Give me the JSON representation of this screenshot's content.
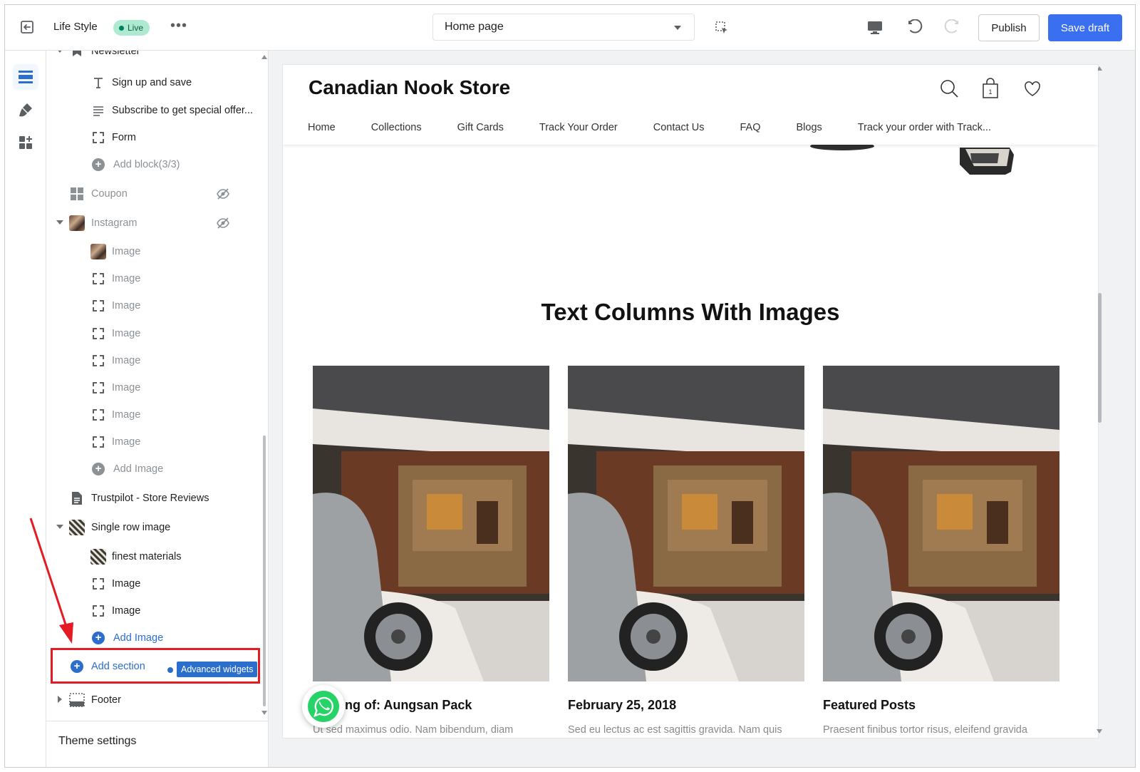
{
  "topbar": {
    "theme_name": "Life Style",
    "live_badge": "Live",
    "more_label": "•••",
    "page_select": "Home page",
    "publish_label": "Publish",
    "save_label": "Save draft"
  },
  "sidebar": {
    "partial_label": "Newsletter",
    "items": [
      {
        "type": "block",
        "icon": "text-icon",
        "label": "Sign up and save"
      },
      {
        "type": "block",
        "icon": "paragraph-icon",
        "label": "Subscribe to get special offer..."
      },
      {
        "type": "block",
        "icon": "dashed-box-icon",
        "label": "Form"
      },
      {
        "type": "add",
        "label": "Add block(3/3)"
      },
      {
        "type": "section",
        "icon": "grid-icon",
        "label": "Coupon",
        "hidden": true
      },
      {
        "type": "section",
        "icon": "image-thumb-icon",
        "label": "Instagram",
        "hidden": true,
        "expanded": true
      },
      {
        "type": "block",
        "icon": "image-thumb-icon",
        "label": "Image"
      },
      {
        "type": "block",
        "icon": "dashed-box-icon",
        "label": "Image"
      },
      {
        "type": "block",
        "icon": "dashed-box-icon",
        "label": "Image"
      },
      {
        "type": "block",
        "icon": "dashed-box-icon",
        "label": "Image"
      },
      {
        "type": "block",
        "icon": "dashed-box-icon",
        "label": "Image"
      },
      {
        "type": "block",
        "icon": "dashed-box-icon",
        "label": "Image"
      },
      {
        "type": "block",
        "icon": "dashed-box-icon",
        "label": "Image"
      },
      {
        "type": "block",
        "icon": "dashed-box-icon",
        "label": "Image"
      },
      {
        "type": "add",
        "label": "Add Image"
      },
      {
        "type": "section",
        "icon": "document-icon",
        "label": "Trustpilot - Store Reviews"
      },
      {
        "type": "section",
        "icon": "pattern-thumb-icon",
        "label": "Single row image",
        "expanded": true
      },
      {
        "type": "block",
        "icon": "pattern-thumb-icon",
        "label": "finest materials"
      },
      {
        "type": "block",
        "icon": "dashed-box-icon",
        "label": "Image"
      },
      {
        "type": "block",
        "icon": "dashed-box-icon",
        "label": "Image"
      },
      {
        "type": "add-blue",
        "label": "Add Image"
      }
    ],
    "add_section_label": "Add section",
    "advanced_widgets_label": "Advanced widgets",
    "footer_label": "Footer",
    "theme_settings_label": "Theme settings"
  },
  "preview": {
    "store_name": "Canadian Nook Store",
    "cart_count": "1",
    "nav": [
      "Home",
      "Collections",
      "Gift Cards",
      "Track Your Order",
      "Contact Us",
      "FAQ",
      "Blogs",
      "Track your order with Track..."
    ],
    "section_title": "Text Columns With Images",
    "columns": [
      {
        "title": "king of: Aungsan Pack",
        "text": "Ut sed maximus odio. Nam bibendum, diam"
      },
      {
        "title": "February 25, 2018",
        "text": "Sed eu lectus ac est sagittis gravida. Nam quis"
      },
      {
        "title": "Featured Posts",
        "text": "Praesent finibus tortor risus, eleifend gravida"
      }
    ]
  },
  "colors": {
    "primary": "#3a6ff0",
    "link": "#2c6ecb",
    "live_bg": "#aee9d1",
    "highlight": "#e41b23"
  }
}
